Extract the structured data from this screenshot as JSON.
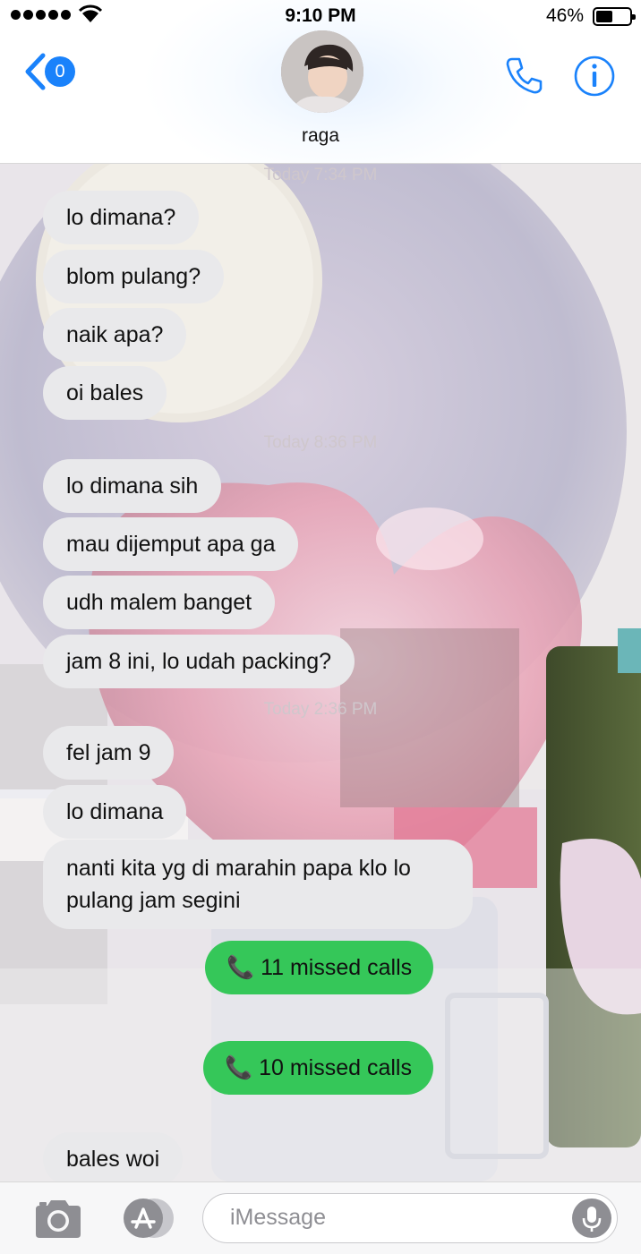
{
  "status_bar": {
    "time": "9:10 PM",
    "battery": "46%"
  },
  "header": {
    "back_count": "0",
    "contact_name": "raga"
  },
  "timestamps": [
    "Today 7:34 PM",
    "Today 8:36 PM",
    "Today 2:36 PM"
  ],
  "messages": [
    {
      "text": "lo dimana?"
    },
    {
      "text": "blom pulang?"
    },
    {
      "text": "naik apa?"
    },
    {
      "text": "oi bales"
    },
    {
      "text": "lo dimana sih"
    },
    {
      "text": "mau dijemput apa ga"
    },
    {
      "text": "udh malem banget"
    },
    {
      "text": "jam 8 ini, lo udah packing?"
    },
    {
      "text": "fel jam 9"
    },
    {
      "text": "lo dimana"
    },
    {
      "text": "nanti kita yg di marahin papa klo lo pulang jam segini"
    },
    {
      "text": "📞 11 missed calls"
    },
    {
      "text": "📞 10 missed calls"
    },
    {
      "text": "bales woi"
    }
  ],
  "composer": {
    "placeholder": "iMessage"
  },
  "colors": {
    "accent_blue": "#1a82fb",
    "received_bubble": "#e9e9eb",
    "sent_bubble": "#35c759"
  },
  "icons": [
    "back-chevron-icon",
    "phone-icon",
    "info-icon",
    "camera-icon",
    "app-store-icon",
    "microphone-icon"
  ]
}
